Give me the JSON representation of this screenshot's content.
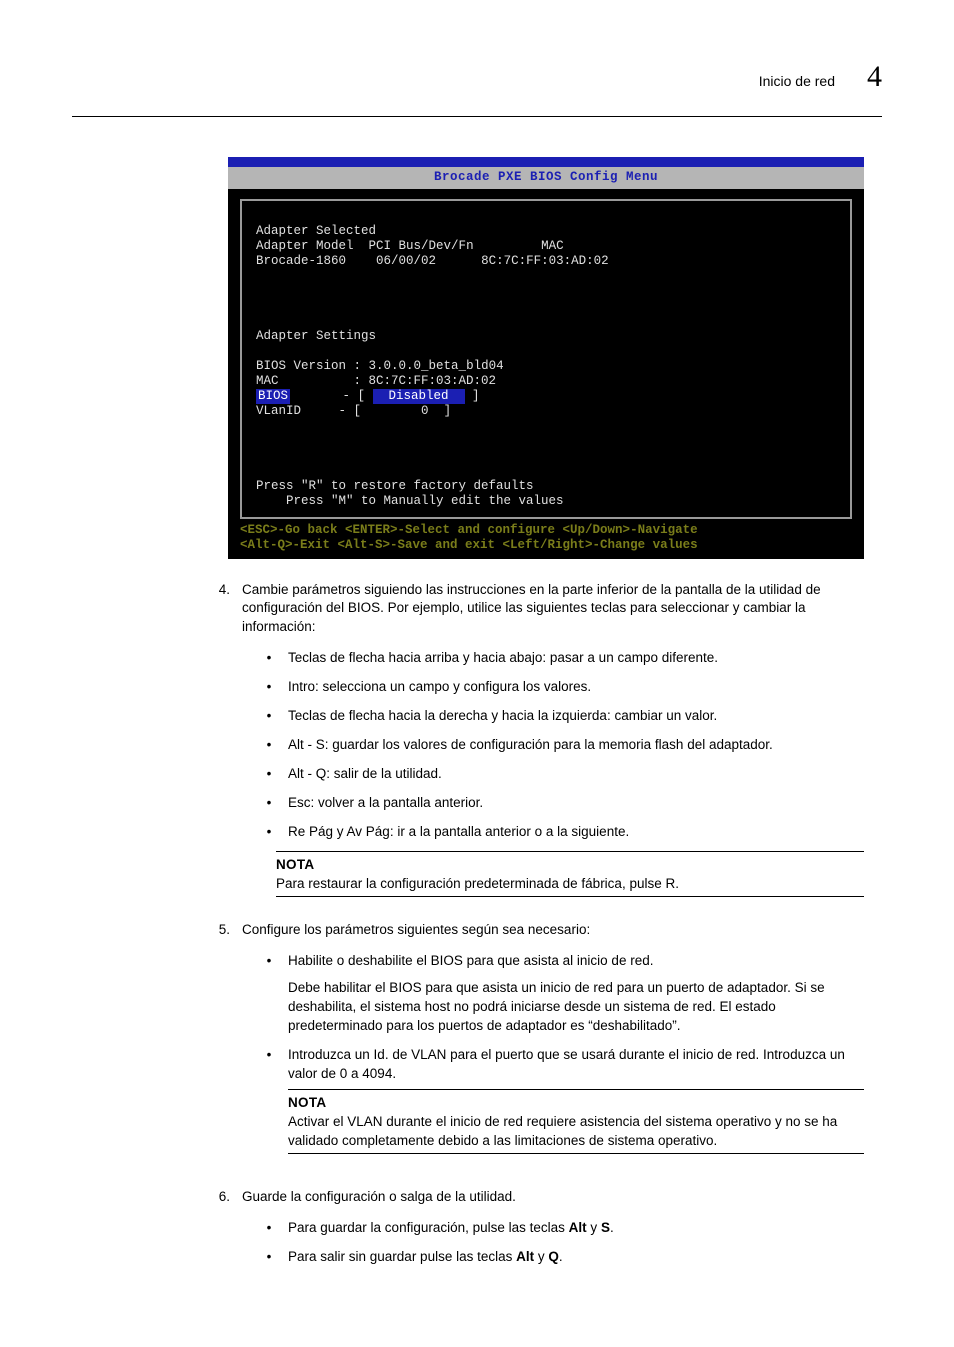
{
  "header": {
    "section": "Inicio de red",
    "chapter_number": "4"
  },
  "bios": {
    "title": "Brocade PXE BIOS Config Menu",
    "selected_hdr": "Adapter Selected",
    "cols": {
      "model_label": "Adapter Model",
      "pci_label": "PCI Bus/Dev/Fn",
      "mac_label": "MAC"
    },
    "row": {
      "model": "Brocade-1860",
      "pci": "06/00/02",
      "mac": "8C:7C:FF:03:AD:02"
    },
    "settings_hdr": "Adapter Settings",
    "bios_ver_label": "BIOS Version :",
    "bios_ver": "3.0.0.0_beta_bld04",
    "mac_label_row": "MAC",
    "mac_val": "8C:7C:FF:03:AD:02",
    "bios_label_row": "BIOS",
    "bios_val": "Disabled",
    "vlan_label": "VLanID",
    "vlan_val": "0",
    "hint_r": "Press \"R\" to restore factory defaults",
    "hint_m": "Press \"M\" to Manually edit the values",
    "footer1": "<ESC>-Go back <ENTER>-Select and configure <Up/Down>-Navigate",
    "footer2": "<Alt-Q>-Exit <Alt-S>-Save and exit <Left/Right>-Change values"
  },
  "step4": {
    "num": "4.",
    "intro": "Cambie parámetros siguiendo las instrucciones en la parte inferior de la pantalla de la utilidad de configuración del BIOS. Por ejemplo, utilice las siguientes teclas para seleccionar y cambiar la información:",
    "bullets": [
      "Teclas de flecha hacia arriba y hacia abajo: pasar a un campo diferente.",
      "Intro: selecciona un campo y configura los valores.",
      "Teclas de flecha hacia la derecha y hacia la izquierda: cambiar un valor.",
      "Alt - S: guardar los valores de configuración para la memoria flash del adaptador.",
      "Alt - Q: salir de la utilidad.",
      "Esc: volver a la pantalla anterior.",
      "Re Pág y Av Pág: ir a la pantalla anterior o a la siguiente."
    ],
    "note_head": "NOTA",
    "note_body": "Para restaurar la configuración predeterminada de fábrica, pulse R."
  },
  "step5": {
    "num": "5.",
    "intro": "Configure los parámetros siguientes según sea necesario:",
    "b1_line": "Habilite o deshabilite el BIOS para que asista al inicio de red.",
    "b1_para": "Debe habilitar el BIOS para que asista un inicio de red para un puerto de adaptador. Si se deshabilita, el sistema host no podrá iniciarse desde un sistema de red. El estado predeterminado para los puertos de adaptador es “deshabilitado”.",
    "b2_line": "Introduzca un Id. de VLAN para el puerto que se usará durante el inicio de red. Introduzca un valor de 0 a 4094.",
    "note_head": "NOTA",
    "note_body": "Activar el VLAN durante el inicio de red requiere asistencia del sistema operativo y no se ha validado completamente debido a las limitaciones de sistema operativo."
  },
  "step6": {
    "num": "6.",
    "intro": "Guarde la configuración o salga de la utilidad.",
    "b1_pre": "Para guardar la configuración, pulse las teclas ",
    "b1_k1": "Alt",
    "b1_mid": " y ",
    "b1_k2": "S",
    "b1_post": ".",
    "b2_pre": "Para salir sin guardar pulse las teclas ",
    "b2_k1": "Alt",
    "b2_mid": " y ",
    "b2_k2": "Q",
    "b2_post": "."
  }
}
